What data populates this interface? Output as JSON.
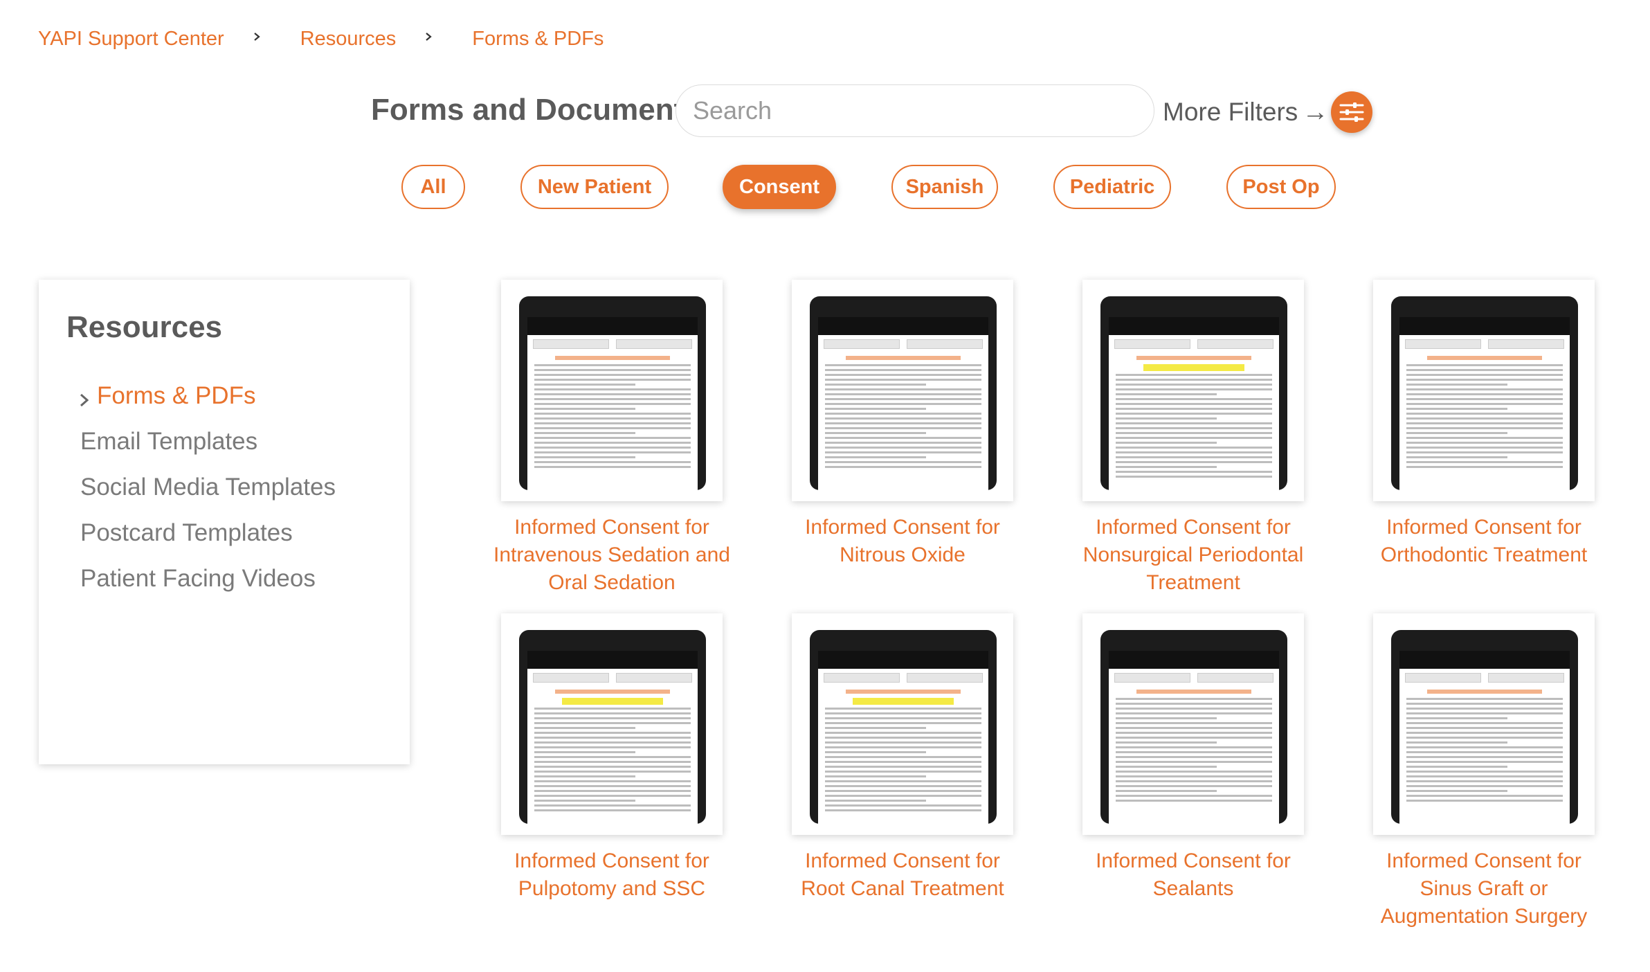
{
  "breadcrumb": [
    "YAPI Support Center",
    "Resources",
    "Forms & PDFs"
  ],
  "header": {
    "title": "Forms and Documents",
    "search_placeholder": "Search",
    "more_filters": "More Filters",
    "arrow": "→"
  },
  "filters": [
    {
      "label": "All",
      "active": false
    },
    {
      "label": "New Patient",
      "active": false
    },
    {
      "label": "Consent",
      "active": true
    },
    {
      "label": "Spanish",
      "active": false
    },
    {
      "label": "Pediatric",
      "active": false
    },
    {
      "label": "Post Op",
      "active": false
    }
  ],
  "sidebar": {
    "title": "Resources",
    "items": [
      {
        "label": "Forms & PDFs",
        "active": true
      },
      {
        "label": "Email Templates",
        "active": false
      },
      {
        "label": "Social Media Templates",
        "active": false
      },
      {
        "label": "Postcard Templates",
        "active": false
      },
      {
        "label": "Patient Facing Videos",
        "active": false
      }
    ]
  },
  "cards": [
    {
      "lines": [
        "Informed Consent for",
        "Intravenous Sedation and",
        "Oral Sedation"
      ]
    },
    {
      "lines": [
        "Informed Consent for",
        "Nitrous Oxide"
      ]
    },
    {
      "lines": [
        "Informed Consent for",
        "Nonsurgical Periodontal",
        "Treatment"
      ]
    },
    {
      "lines": [
        "Informed Consent for",
        "Orthodontic Treatment"
      ]
    },
    {
      "lines": [
        "Informed Consent for",
        "Pulpotomy and SSC"
      ]
    },
    {
      "lines": [
        "Informed Consent for",
        "Root Canal Treatment"
      ]
    },
    {
      "lines": [
        "Informed Consent for",
        "Sealants"
      ]
    },
    {
      "lines": [
        "Informed Consent for",
        "Sinus Graft or",
        "Augmentation Surgery"
      ]
    }
  ],
  "colors": {
    "accent": "#e8722c",
    "text": "#5a5a5a",
    "muted": "#7a7a7a"
  }
}
